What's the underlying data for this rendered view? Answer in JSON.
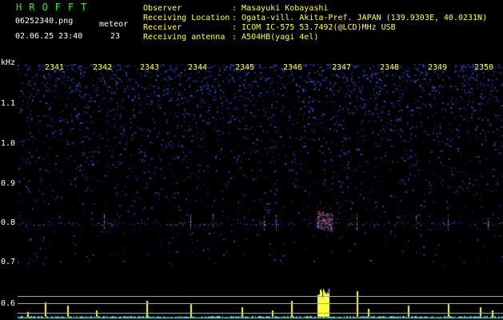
{
  "header": {
    "title": "HROFFT",
    "filename": "06252340.png",
    "timestamp": "02.06.25 23:40",
    "meteor_label": "meteor",
    "meteor_count": "23",
    "labels": [
      "Observer",
      "Receiving Location",
      "Receiver",
      "Receiving antenna"
    ],
    "values": [
      ": Masayuki Kobayashi",
      ": Ogata-vill. Akita-Pref. JAPAN (139.9303E, 40.0231N)",
      ": ICOM IC-575 53.7492(@LCD)MHz USB",
      ": A504HB(yagi 4el)"
    ]
  },
  "x_ticks": [
    "2341",
    "2342",
    "2343",
    "2344",
    "2345",
    "2346",
    "2347",
    "2348",
    "2349",
    "2350"
  ],
  "y_unit": "kHz",
  "y_ticks": [
    "1.1",
    "1.0",
    "0.9",
    "0.8",
    "0.7",
    "0.6"
  ],
  "colors": {
    "background": "#000000",
    "noise": "#2030c0",
    "carrier": "#40c0ff",
    "echo": "#ff3030",
    "activity_bar": "#ffff40",
    "baseline": "#40e0e0"
  }
}
